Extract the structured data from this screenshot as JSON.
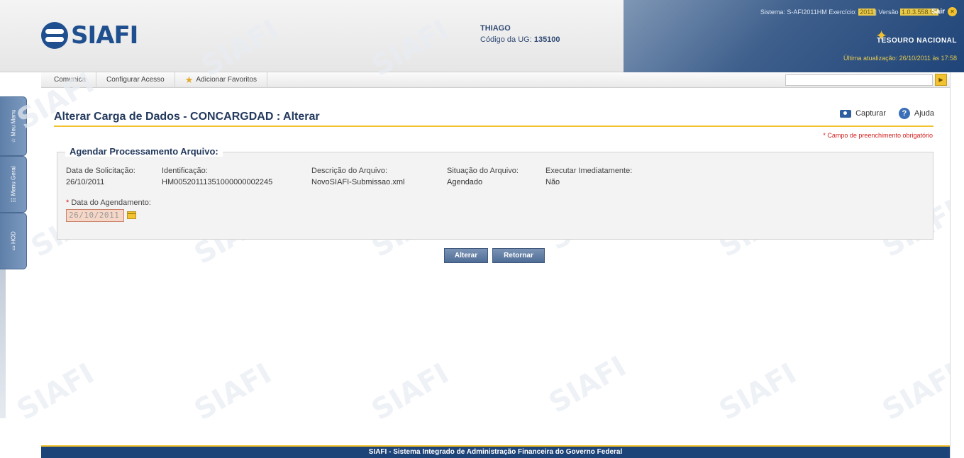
{
  "header": {
    "logo_text": "SIAFI",
    "user_name": "THIAGO",
    "ug_label": "Código da UG:",
    "ug_value": "135100",
    "system_status_prefix": "Sistema: S-AFI2011HM Exercício: ",
    "exercicio": "2011",
    "versao_label": "| Versão ",
    "versao": "1.0.3.558.97",
    "sair_label": "Sair",
    "tesouro_label": "TESOURO NACIONAL",
    "last_update": "Última atualização: 26/10/2011 às 17:58"
  },
  "menu": {
    "items": [
      {
        "label": "Comunica"
      },
      {
        "label": "Configurar Acesso"
      },
      {
        "label": "Adicionar Favoritos"
      }
    ],
    "search_value": ""
  },
  "sidebar": {
    "tabs": [
      {
        "label": "Meu Menu"
      },
      {
        "label": "Menu Geral"
      },
      {
        "label": "HOD"
      }
    ]
  },
  "page": {
    "title": "Alterar Carga de Dados - CONCARGDAD : Alterar",
    "capture_label": "Capturar",
    "help_label": "Ajuda",
    "required_note": "* Campo de preenchimento obrigatório"
  },
  "form": {
    "legend": "Agendar Processamento Arquivo:",
    "fields": [
      {
        "label": "Data de Solicitação:",
        "value": "26/10/2011"
      },
      {
        "label": "Identificação:",
        "value": "HM00520111351000000002245"
      },
      {
        "label": "Descrição do Arquivo:",
        "value": "NovoSIAFI-Submissao.xml"
      },
      {
        "label": "Situação do Arquivo:",
        "value": "Agendado"
      },
      {
        "label": "Executar Imediatamente:",
        "value": "Não"
      }
    ],
    "schedule_required_mark": "*",
    "schedule_label": "Data do Agendamento:",
    "schedule_value": "26/10/2011"
  },
  "actions": {
    "alterar": "Alterar",
    "retornar": "Retornar"
  },
  "footer": {
    "text": "SIAFI - Sistema Integrado de Administração Financeira do Governo Federal"
  },
  "watermark": "SIAFI"
}
